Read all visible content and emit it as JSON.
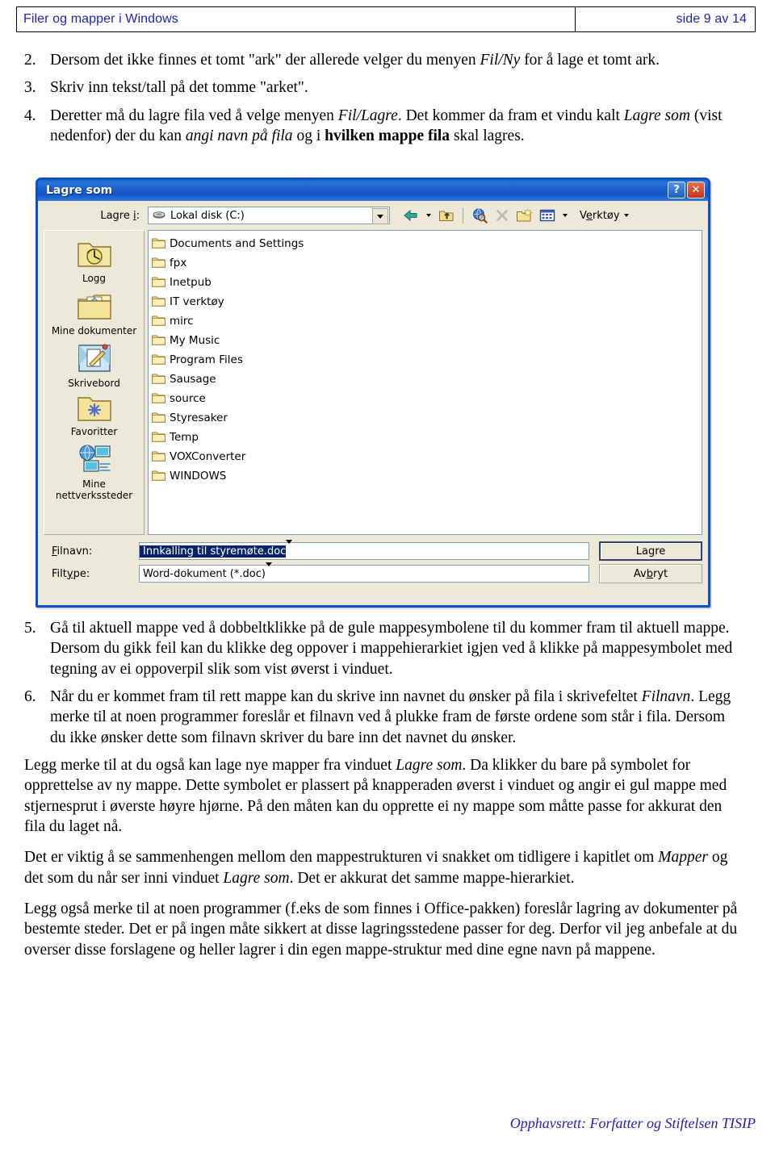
{
  "header": {
    "left_title": "Filer og mapper i Windows",
    "right_page": "side 9 av 14"
  },
  "body": {
    "steps": [
      {
        "num": "2.",
        "parts": [
          {
            "t": "Dersom det ikke finnes et tomt \"ark\" der allerede velger du menyen ",
            "s": "normal"
          },
          {
            "t": "Fil/Ny",
            "s": "italic"
          },
          {
            "t": " for å lage et tomt ark.",
            "s": "normal"
          }
        ]
      },
      {
        "num": "3.",
        "parts": [
          {
            "t": "Skriv inn tekst/tall på det tomme \"arket\".",
            "s": "normal"
          }
        ]
      },
      {
        "num": "4.",
        "parts": [
          {
            "t": "Deretter må du lagre fila ved å velge menyen ",
            "s": "normal"
          },
          {
            "t": "Fil/Lagre",
            "s": "italic"
          },
          {
            "t": ". Det kommer da fram et vindu kalt ",
            "s": "normal"
          },
          {
            "t": "Lagre som",
            "s": "italic"
          },
          {
            "t": " (vist nedenfor) der du kan ",
            "s": "normal"
          },
          {
            "t": "angi navn på fila",
            "s": "italic"
          },
          {
            "t": " og i ",
            "s": "normal"
          },
          {
            "t": "hvilken mappe fila",
            "s": "bold"
          },
          {
            "t": " skal lagres.",
            "s": "normal"
          }
        ]
      }
    ],
    "steps_after": [
      {
        "num": "5.",
        "parts": [
          {
            "t": "Gå til aktuell mappe ved å dobbeltklikke på de gule mappesymbolene til du kommer fram til aktuell mappe. Dersom du gikk feil kan du klikke deg oppover i mappehierarkiet igjen ved å klikke på mappesymbolet med tegning av ei oppoverpil slik som vist øverst i vinduet.",
            "s": "normal"
          }
        ]
      },
      {
        "num": "6.",
        "parts": [
          {
            "t": "Når du er kommet fram til rett mappe kan du skrive inn navnet du ønsker på fila i skrivefeltet ",
            "s": "normal"
          },
          {
            "t": "Filnavn",
            "s": "italic"
          },
          {
            "t": ". Legg merke til at noen programmer foreslår et filnavn ved å plukke fram de første ordene som står i fila. Dersom du ikke ønsker dette som filnavn skriver du bare inn det navnet du ønsker.",
            "s": "normal"
          }
        ]
      }
    ],
    "paragraphs": [
      {
        "parts": [
          {
            "t": "Legg merke til at du også kan lage nye mapper fra vinduet ",
            "s": "normal"
          },
          {
            "t": "Lagre som",
            "s": "italic"
          },
          {
            "t": ". Da klikker du bare på symbolet for opprettelse av ny mappe. Dette symbolet er plassert på knapperaden øverst i vinduet og angir ei gul mappe med stjernesprut i øverste høyre hjørne. På den måten kan du opprette ei ny mappe som måtte passe for akkurat den fila du laget nå.",
            "s": "normal"
          }
        ]
      },
      {
        "parts": [
          {
            "t": "Det er viktig å se sammenhengen mellom den mappestrukturen vi snakket om tidligere i kapitlet om ",
            "s": "normal"
          },
          {
            "t": "Mapper",
            "s": "italic"
          },
          {
            "t": " og det som du når ser inni vinduet ",
            "s": "normal"
          },
          {
            "t": "Lagre som",
            "s": "italic"
          },
          {
            "t": ". Det er akkurat det samme mappe-hierarkiet.",
            "s": "normal"
          }
        ]
      },
      {
        "parts": [
          {
            "t": "Legg også merke til at noen programmer (f.eks de som finnes i Office-pakken) foreslår lagring av dokumenter på bestemte steder. Det er på ingen måte sikkert at disse lagringsstedene passer for deg. Derfor vil jeg anbefale at du overser disse forslagene og heller lagrer i din egen mappe-struktur med dine egne navn på mappene.",
            "s": "normal"
          }
        ]
      }
    ]
  },
  "dialog": {
    "title": "Lagre som",
    "help_label": "?",
    "close_label": "✕",
    "lookin_label": "Lagre i:",
    "lookin_value": "Lokal disk (C:)",
    "toolbar": {
      "back_icon": "back-arrow-icon",
      "back_dropdown_icon": "chevron-down-icon",
      "up_icon": "up-one-level-icon",
      "search_icon": "search-web-icon",
      "delete_icon": "delete-x-icon",
      "newfolder_icon": "new-folder-icon",
      "views_icon": "views-icon",
      "views_dropdown_icon": "chevron-down-icon",
      "tools_label": "Verktøy",
      "tools_dropdown_icon": "chevron-down-icon"
    },
    "places": [
      {
        "label": "Logg",
        "icon": "history-folder-icon"
      },
      {
        "label": "Mine dokumenter",
        "icon": "my-documents-icon"
      },
      {
        "label": "Skrivebord",
        "icon": "desktop-icon"
      },
      {
        "label": "Favoritter",
        "icon": "favorites-folder-icon"
      },
      {
        "label": "Mine nettverkssteder",
        "icon": "my-network-places-icon"
      }
    ],
    "files": [
      "Documents and Settings",
      "fpx",
      "Inetpub",
      "IT verktøy",
      "mirc",
      "My Music",
      "Program Files",
      "Sausage",
      "source",
      "Styresaker",
      "Temp",
      "VOXConverter",
      "WINDOWS"
    ],
    "filename_label": "Filnavn:",
    "filename_value": "Innkalling til styremøte.doc",
    "filetype_label": "Filtype:",
    "filetype_value": "Word-dokument (*.doc)",
    "save_button": "Lagre",
    "cancel_button": "Avbryt"
  },
  "footer": {
    "text": "Opphavsrett:  Forfatter og Stiftelsen TISIP"
  },
  "colors": {
    "link_blue": "#2222bb",
    "titlebar_blue": "#1a5fcd",
    "dialog_face": "#ece9d8",
    "selection_blue": "#0a246a",
    "folder_yellow": "#fbe38a"
  }
}
